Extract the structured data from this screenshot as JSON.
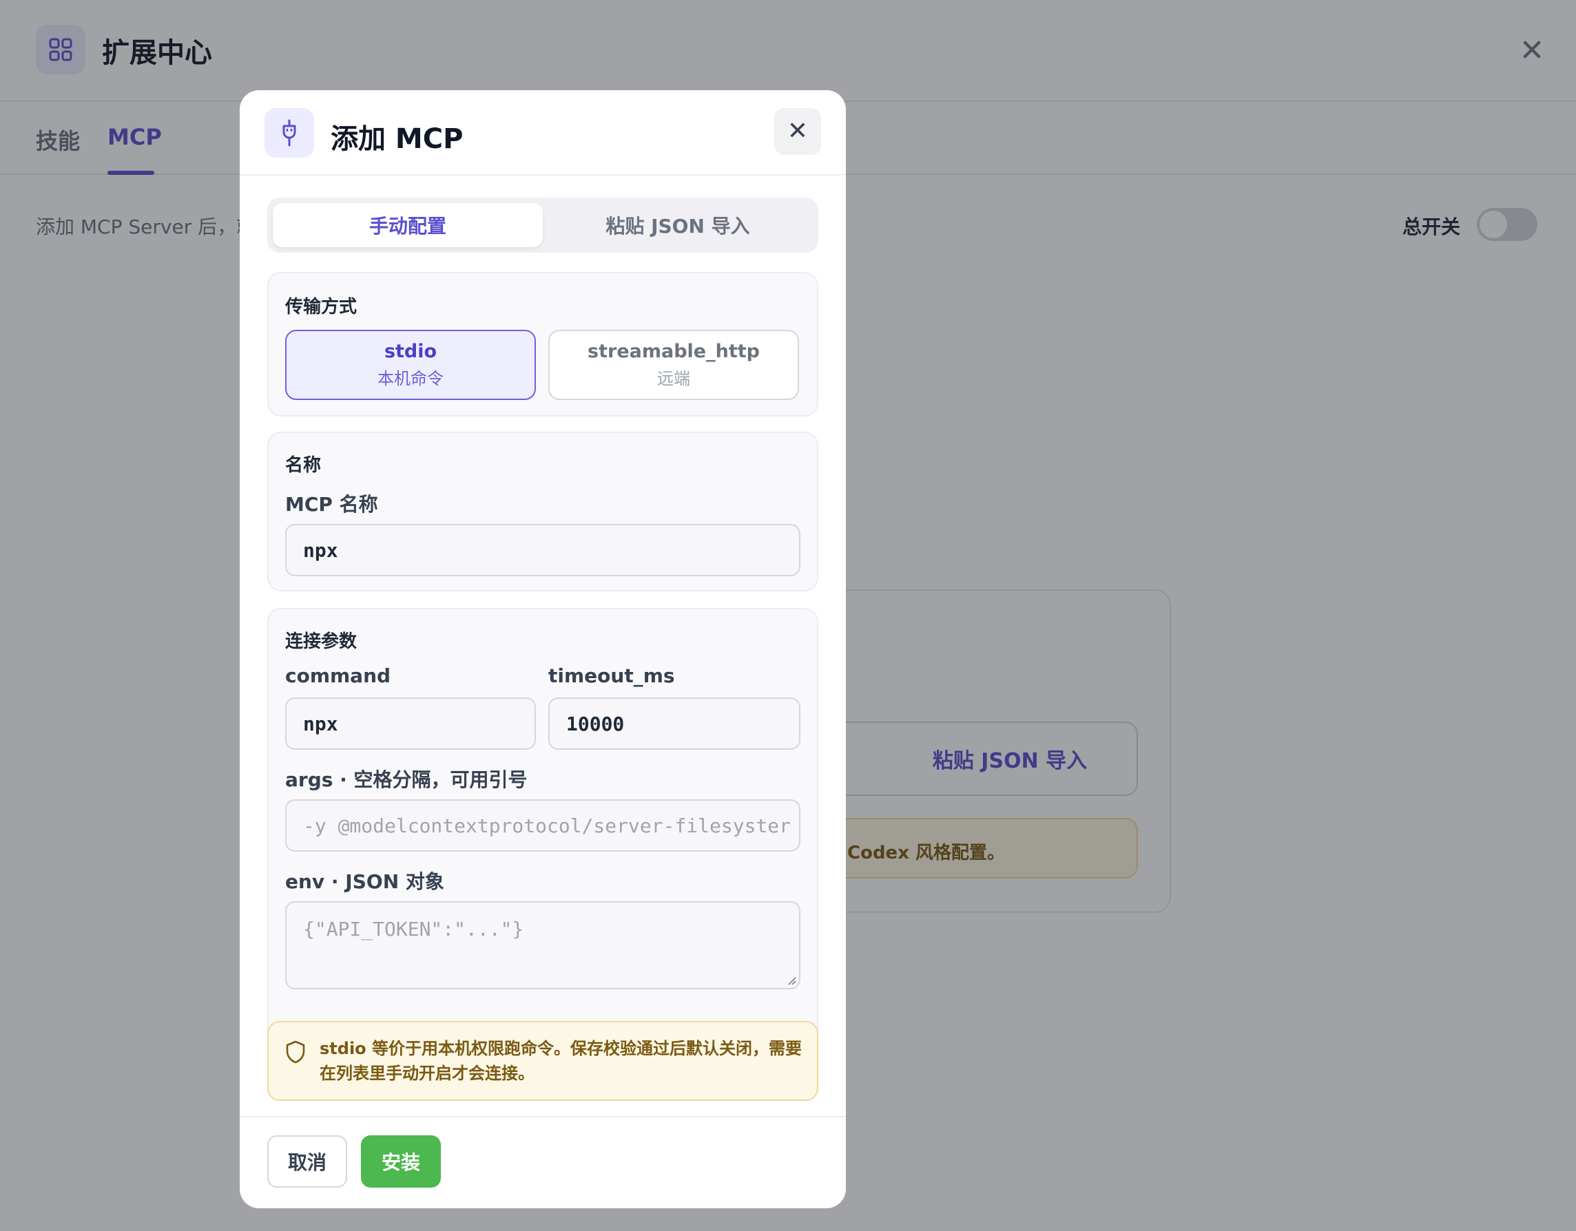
{
  "app": {
    "title": "扩展中心",
    "icon": "grid-icon",
    "close_glyph": "✕"
  },
  "tabs": [
    {
      "label": "技能",
      "active": false
    },
    {
      "label": "MCP",
      "active": true
    }
  ],
  "page": {
    "description": "添加 MCP Server 后，就",
    "master_switch_label": "总开关",
    "master_switch_on": false,
    "card_paste_button": "粘贴 JSON 导入",
    "card_note": "Codex 风格配置。"
  },
  "modal": {
    "icon": "plug-icon",
    "title": "添加 MCP",
    "close_glyph": "✕",
    "mode_tabs": {
      "manual": "手动配置",
      "paste": "粘贴 JSON 导入",
      "active": "manual"
    },
    "transport": {
      "section_label": "传输方式",
      "selected": "stdio",
      "options": [
        {
          "name": "stdio",
          "sub": "本机命令"
        },
        {
          "name": "streamable_http",
          "sub": "远端"
        }
      ]
    },
    "name_section": {
      "section_label": "名称",
      "field_label": "MCP 名称",
      "value": "npx"
    },
    "connection": {
      "section_label": "连接参数",
      "command_label": "command",
      "command_value": "npx",
      "timeout_label": "timeout_ms",
      "timeout_value": "10000",
      "args_label": "args · 空格分隔，可用引号",
      "args_placeholder": "-y @modelcontextprotocol/server-filesyster",
      "env_label": "env · JSON 对象",
      "env_placeholder": "{\"API_TOKEN\":\"...\"}"
    },
    "warning": {
      "icon": "shield-icon",
      "text": "stdio 等价于用本机权限跑命令。保存校验通过后默认关闭，需要在列表里手动开启才会连接。"
    },
    "footer": {
      "cancel": "取消",
      "install": "安装"
    }
  },
  "colors": {
    "accent": "#5b4fcf",
    "install_green": "#4cb84f",
    "warning_bg": "#fdf7e6",
    "warning_text": "#7a5a12"
  }
}
